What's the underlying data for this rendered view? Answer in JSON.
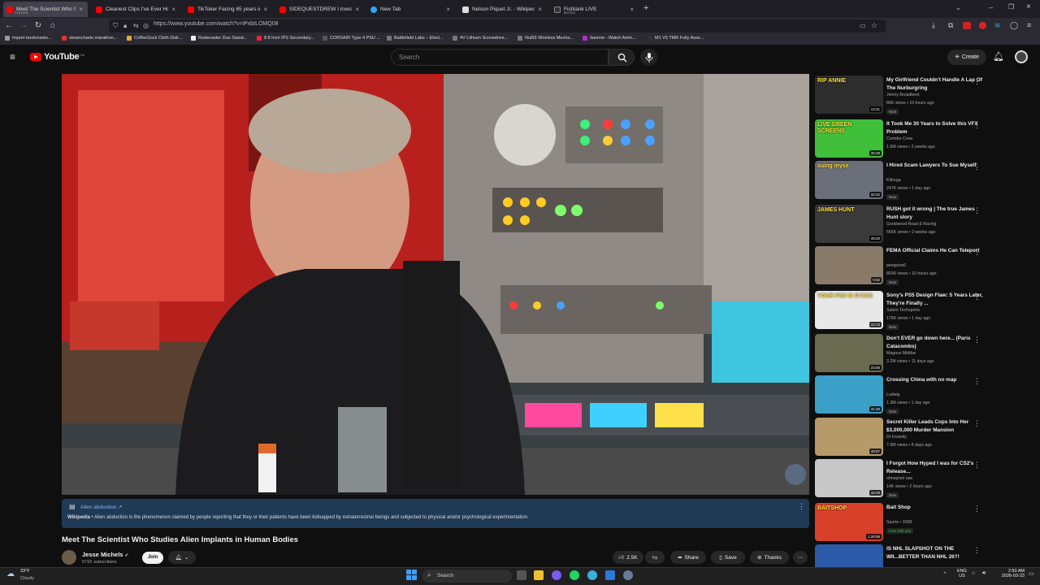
{
  "browser": {
    "tabs": [
      {
        "title": "Meet The Scientist Who Studie",
        "subtitle": "PLAYING",
        "color": "#ff0000",
        "active": true
      },
      {
        "title": "Cleanest Clips I've Ever Hit...",
        "color": "#ff0000"
      },
      {
        "title": "TikToker Facing 65 years in Pri",
        "color": "#ff0000"
      },
      {
        "title": "SIDEQUESTDREW I investigate",
        "color": "#ff0000"
      },
      {
        "title": "New Tab",
        "color": "#2fa6ff"
      },
      {
        "title": "Nelson Piquet Jr. - Wikipedia",
        "color": "#dddddd"
      },
      {
        "title": "Fishtank LIVE",
        "subtitle": "MUTED",
        "color": "#333333"
      }
    ],
    "url": "https://www.youtube.com/watch?v=iPxbILOMQ08",
    "bookmarks": [
      "Import bookmarks...",
      "steamcharts marathon...",
      "CoffeeSock Cloth Disk...",
      "Rodecaster Duo Stand...",
      "8.8 Inch IPS Secondary...",
      "CORSAIR Type 4 PSU ...",
      "Battlefield Labs – Elect...",
      "4V Lithium Screwdrive...",
      "Nut65 Wireless Mecha...",
      "9anime - Watch Anim...",
      "M1 V5 TMR Fully Asse..."
    ]
  },
  "youtube": {
    "logo": "YouTube",
    "region": "CA",
    "search_placeholder": "Search",
    "create_label": "Create"
  },
  "video": {
    "wiki_label": "Alien abduction",
    "wiki_source": "Wikipedia",
    "wiki_text": "Alien abduction is the phenomenon claimed by people reporting that they or their patients have been kidnapped by extraterrestrial beings and subjected to physical and/or psychological experimentation.",
    "title": "Meet The Scientist Who Studies Alien Implants in Human Bodies",
    "channel": "Jesse Michels",
    "subscribers": "571K subscribers",
    "join_label": "Join",
    "likes": "2.5K",
    "share_label": "Share",
    "save_label": "Save",
    "thanks_label": "Thanks"
  },
  "recommendations": [
    {
      "title": "My Girlfriend Couldn't Handle A Lap Of The Nurburgring",
      "channel": "Jimmy Broadbent",
      "meta": "86K views • 10 hours ago",
      "badge": "New",
      "duration": "13:31",
      "thumb": "#2d2d2d",
      "thumb_text": "RIP ANNIE"
    },
    {
      "title": "It Took Me 30 Years to Solve this VFX Problem",
      "channel": "Corridor Crew",
      "meta": "1.5M views • 2 weeks ago",
      "badge": "",
      "duration": "30:29",
      "thumb": "#3fbf3a",
      "thumb_text": "LIVE GREEN SCREENS"
    },
    {
      "title": "I Hired Scam Lawyers To Sue Myself",
      "channel": "Kitboga",
      "meta": "247K views • 1 day ago",
      "badge": "New",
      "duration": "33:32",
      "thumb": "#6b6f7a",
      "thumb_text": "suing myse"
    },
    {
      "title": "RUSH got it wrong | The true James Hunt story",
      "channel": "Goodwood Road & Racing",
      "meta": "565K views • 2 weeks ago",
      "badge": "",
      "duration": "49:20",
      "thumb": "#3a3a3a",
      "thumb_text": "JAMES HUNT"
    },
    {
      "title": "FEMA Official Claims He Can Teleport",
      "channel": "penguinz0",
      "meta": "803K views • 10 hours ago",
      "badge": "New",
      "duration": "9:02",
      "thumb": "#8a7a6a",
      "thumb_text": ""
    },
    {
      "title": "Sony's PS5 Design Flaw: 5 Years Later, They're Finally ...",
      "channel": "Salem Techsperts",
      "meta": "176K views • 1 day ago",
      "badge": "New",
      "duration": "22:13",
      "thumb": "#e8e8e8",
      "thumb_text": "YOUR PS5 IS DYING"
    },
    {
      "title": "Don't EVER go down here... (Paris Catacombs)",
      "channel": "Magnus Midtbø",
      "meta": "3.2M views • 11 days ago",
      "badge": "",
      "duration": "23:06",
      "thumb": "#6a6a50",
      "thumb_text": ""
    },
    {
      "title": "Crossing China with no map",
      "channel": "Ludwig",
      "meta": "1.3M views • 1 day ago",
      "badge": "New",
      "duration": "41:30",
      "thumb": "#3aa0c8",
      "thumb_text": ""
    },
    {
      "title": "Secret Killer Leads Cops Into Her $3,000,000 Murder Mansion",
      "channel": "Dr Insanity",
      "meta": "7.9M views • 8 days ago",
      "badge": "",
      "duration": "49:57",
      "thumb": "#b79a6a",
      "thumb_text": ""
    },
    {
      "title": "I Forgot How Hyped I was for CS2's Release...",
      "channel": "ohnepixel raw",
      "meta": "14K views • 2 hours ago",
      "badge": "New",
      "duration": "16:28",
      "thumb": "#c8c8c8",
      "thumb_text": ""
    },
    {
      "title": "Bait Shop",
      "channel": "Sports • 2008",
      "meta": "",
      "badge": "Free with ads",
      "duration": "1:25:59",
      "thumb": "#d8402a",
      "thumb_text": "BAITSHOP"
    },
    {
      "title": "IS NHL SLAPSHOT ON THE WII...BETTER THAN NHL 26?!",
      "channel": "",
      "meta": "",
      "badge": "",
      "duration": "",
      "thumb": "#2a5aa8",
      "thumb_text": ""
    }
  ],
  "taskbar": {
    "weather_temp": "33°F",
    "weather_desc": "Cloudy",
    "search_label": "Search",
    "lang1": "ENG",
    "lang2": "US",
    "time": "2:50 AM",
    "date": "2026-03-23"
  }
}
